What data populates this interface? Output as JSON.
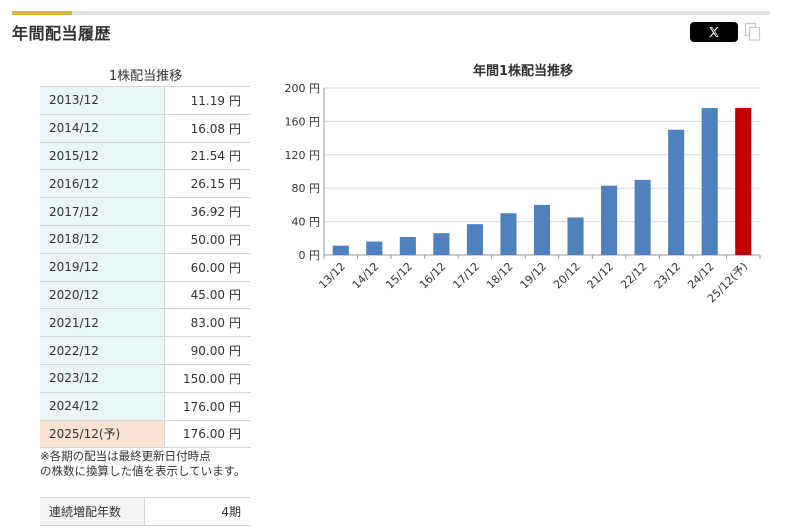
{
  "section": {
    "title": "年間配当履歴"
  },
  "colors": {
    "accent": "#d9b44a",
    "bar": "#4f81bd",
    "bar_forecast": "#c00000",
    "year_cell": "#eaf5f7",
    "forecast_cell": "#fde3d3"
  },
  "icons": {
    "share": "x-logo-icon",
    "copy": "copy-icon"
  },
  "table": {
    "caption": "1株配当推移",
    "unit": "円",
    "rows": [
      {
        "period": "2013/12",
        "value": "11.19"
      },
      {
        "period": "2014/12",
        "value": "16.08"
      },
      {
        "period": "2015/12",
        "value": "21.54"
      },
      {
        "period": "2016/12",
        "value": "26.15"
      },
      {
        "period": "2017/12",
        "value": "36.92"
      },
      {
        "period": "2018/12",
        "value": "50.00"
      },
      {
        "period": "2019/12",
        "value": "60.00"
      },
      {
        "period": "2020/12",
        "value": "45.00"
      },
      {
        "period": "2021/12",
        "value": "83.00"
      },
      {
        "period": "2022/12",
        "value": "90.00"
      },
      {
        "period": "2023/12",
        "value": "150.00"
      },
      {
        "period": "2024/12",
        "value": "176.00"
      },
      {
        "period": "2025/12(予)",
        "value": "176.00",
        "forecast": true
      }
    ]
  },
  "note": {
    "line1": "※各期の配当は最終更新日付時点",
    "line2": "の株数に換算した値を表示しています。"
  },
  "streak": {
    "label": "連続増配年数",
    "value": "4期"
  },
  "chart_data": {
    "type": "bar",
    "title": "年間1株配当推移",
    "categories": [
      "13/12",
      "14/12",
      "15/12",
      "16/12",
      "17/12",
      "18/12",
      "19/12",
      "20/12",
      "21/12",
      "22/12",
      "23/12",
      "24/12",
      "25/12(予)"
    ],
    "values": [
      11.19,
      16.08,
      21.54,
      26.15,
      36.92,
      50.0,
      60.0,
      45.0,
      83.0,
      90.0,
      150.0,
      176.0,
      176.0
    ],
    "forecast_index": 12,
    "ylim": [
      0,
      200
    ],
    "yticks": [
      0,
      40,
      80,
      120,
      160,
      200
    ],
    "ytick_suffix": " 円",
    "grid": true,
    "legend": "none"
  }
}
